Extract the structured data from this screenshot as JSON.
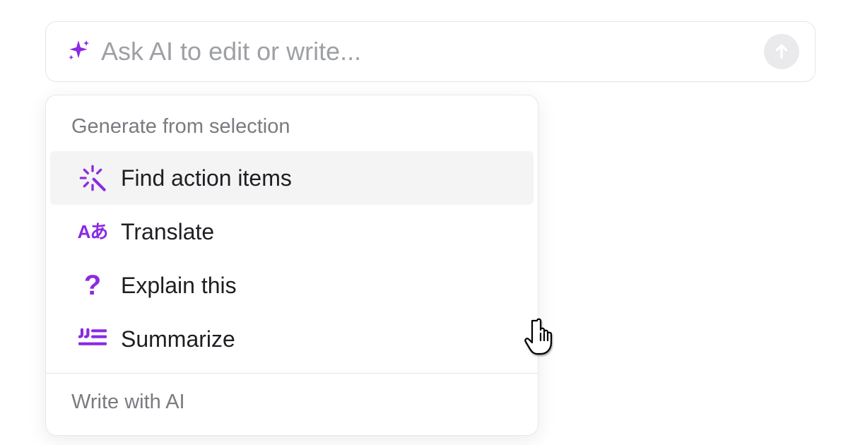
{
  "colors": {
    "accent": "#8A2BE2",
    "muted": "#9EA0A6",
    "panel_border": "#E8E8EA",
    "highlight_bg": "#F4F4F5"
  },
  "input": {
    "placeholder": "Ask AI to edit or write...",
    "value": ""
  },
  "menu": {
    "section1_label": "Generate from selection",
    "items": [
      {
        "icon": "wand",
        "label": "Find action items",
        "highlighted": true
      },
      {
        "icon": "translate",
        "label": "Translate",
        "highlighted": false
      },
      {
        "icon": "question",
        "label": "Explain this",
        "highlighted": false
      },
      {
        "icon": "summarize",
        "label": "Summarize",
        "highlighted": false
      }
    ],
    "section2_label": "Write with AI",
    "translate_glyph": "Aあ"
  }
}
